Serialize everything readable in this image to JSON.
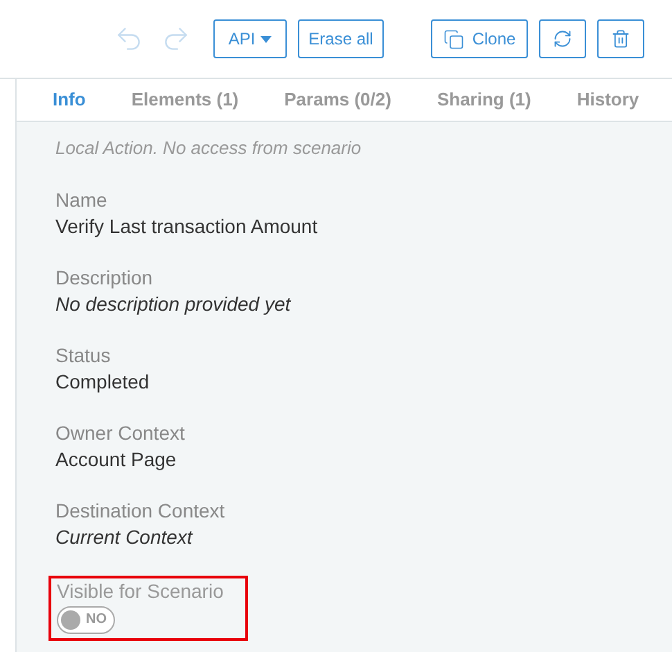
{
  "toolbar": {
    "undo": {
      "disabled": true
    },
    "redo": {
      "disabled": true
    },
    "api_button": {
      "label": "API"
    },
    "erase_button": {
      "label": "Erase all"
    },
    "clone_button": {
      "label": "Clone"
    }
  },
  "tabs": [
    {
      "label": "Info",
      "selected": true
    },
    {
      "label": "Elements (1)",
      "selected": false
    },
    {
      "label": "Params (0/2)",
      "selected": false
    },
    {
      "label": "Sharing (1)",
      "selected": false
    },
    {
      "label": "History",
      "selected": false
    }
  ],
  "note": "Local Action. No access from scenario",
  "fields": [
    {
      "kind": "text",
      "label": "Name",
      "value": "Verify Last transaction Amount",
      "italic": false
    },
    {
      "kind": "text",
      "label": "Description",
      "value": "No description provided yet",
      "italic": true
    },
    {
      "kind": "text",
      "label": "Status",
      "value": "Completed",
      "italic": false
    },
    {
      "kind": "text",
      "label": "Owner Context",
      "value": "Account Page",
      "italic": false
    },
    {
      "kind": "text",
      "label": "Destination Context",
      "value": "Current Context",
      "italic": true
    },
    {
      "kind": "toggle",
      "label": "Visible for Scenario",
      "value": "NO",
      "on": false,
      "highlighted": true
    }
  ]
}
